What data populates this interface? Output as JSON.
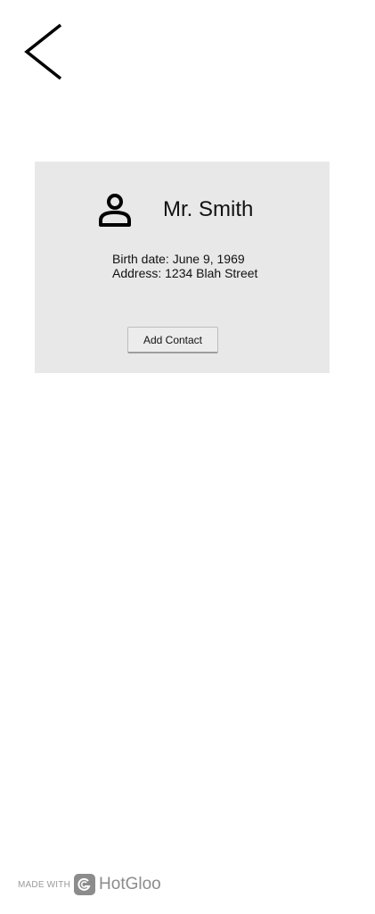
{
  "navigation": {
    "back_icon": "chevron-left-icon"
  },
  "contact_card": {
    "avatar_icon": "person-icon",
    "name": "Mr. Smith",
    "birth_date": "Birth date: June 9, 1969",
    "address": "Address: 1234 Blah Street",
    "add_button_label": "Add Contact",
    "background_color": "#e8e8e8"
  },
  "footer": {
    "made_with": "MADE WITH",
    "brand": "HotGloo",
    "brand_icon": "hotgloo-logo-icon"
  }
}
